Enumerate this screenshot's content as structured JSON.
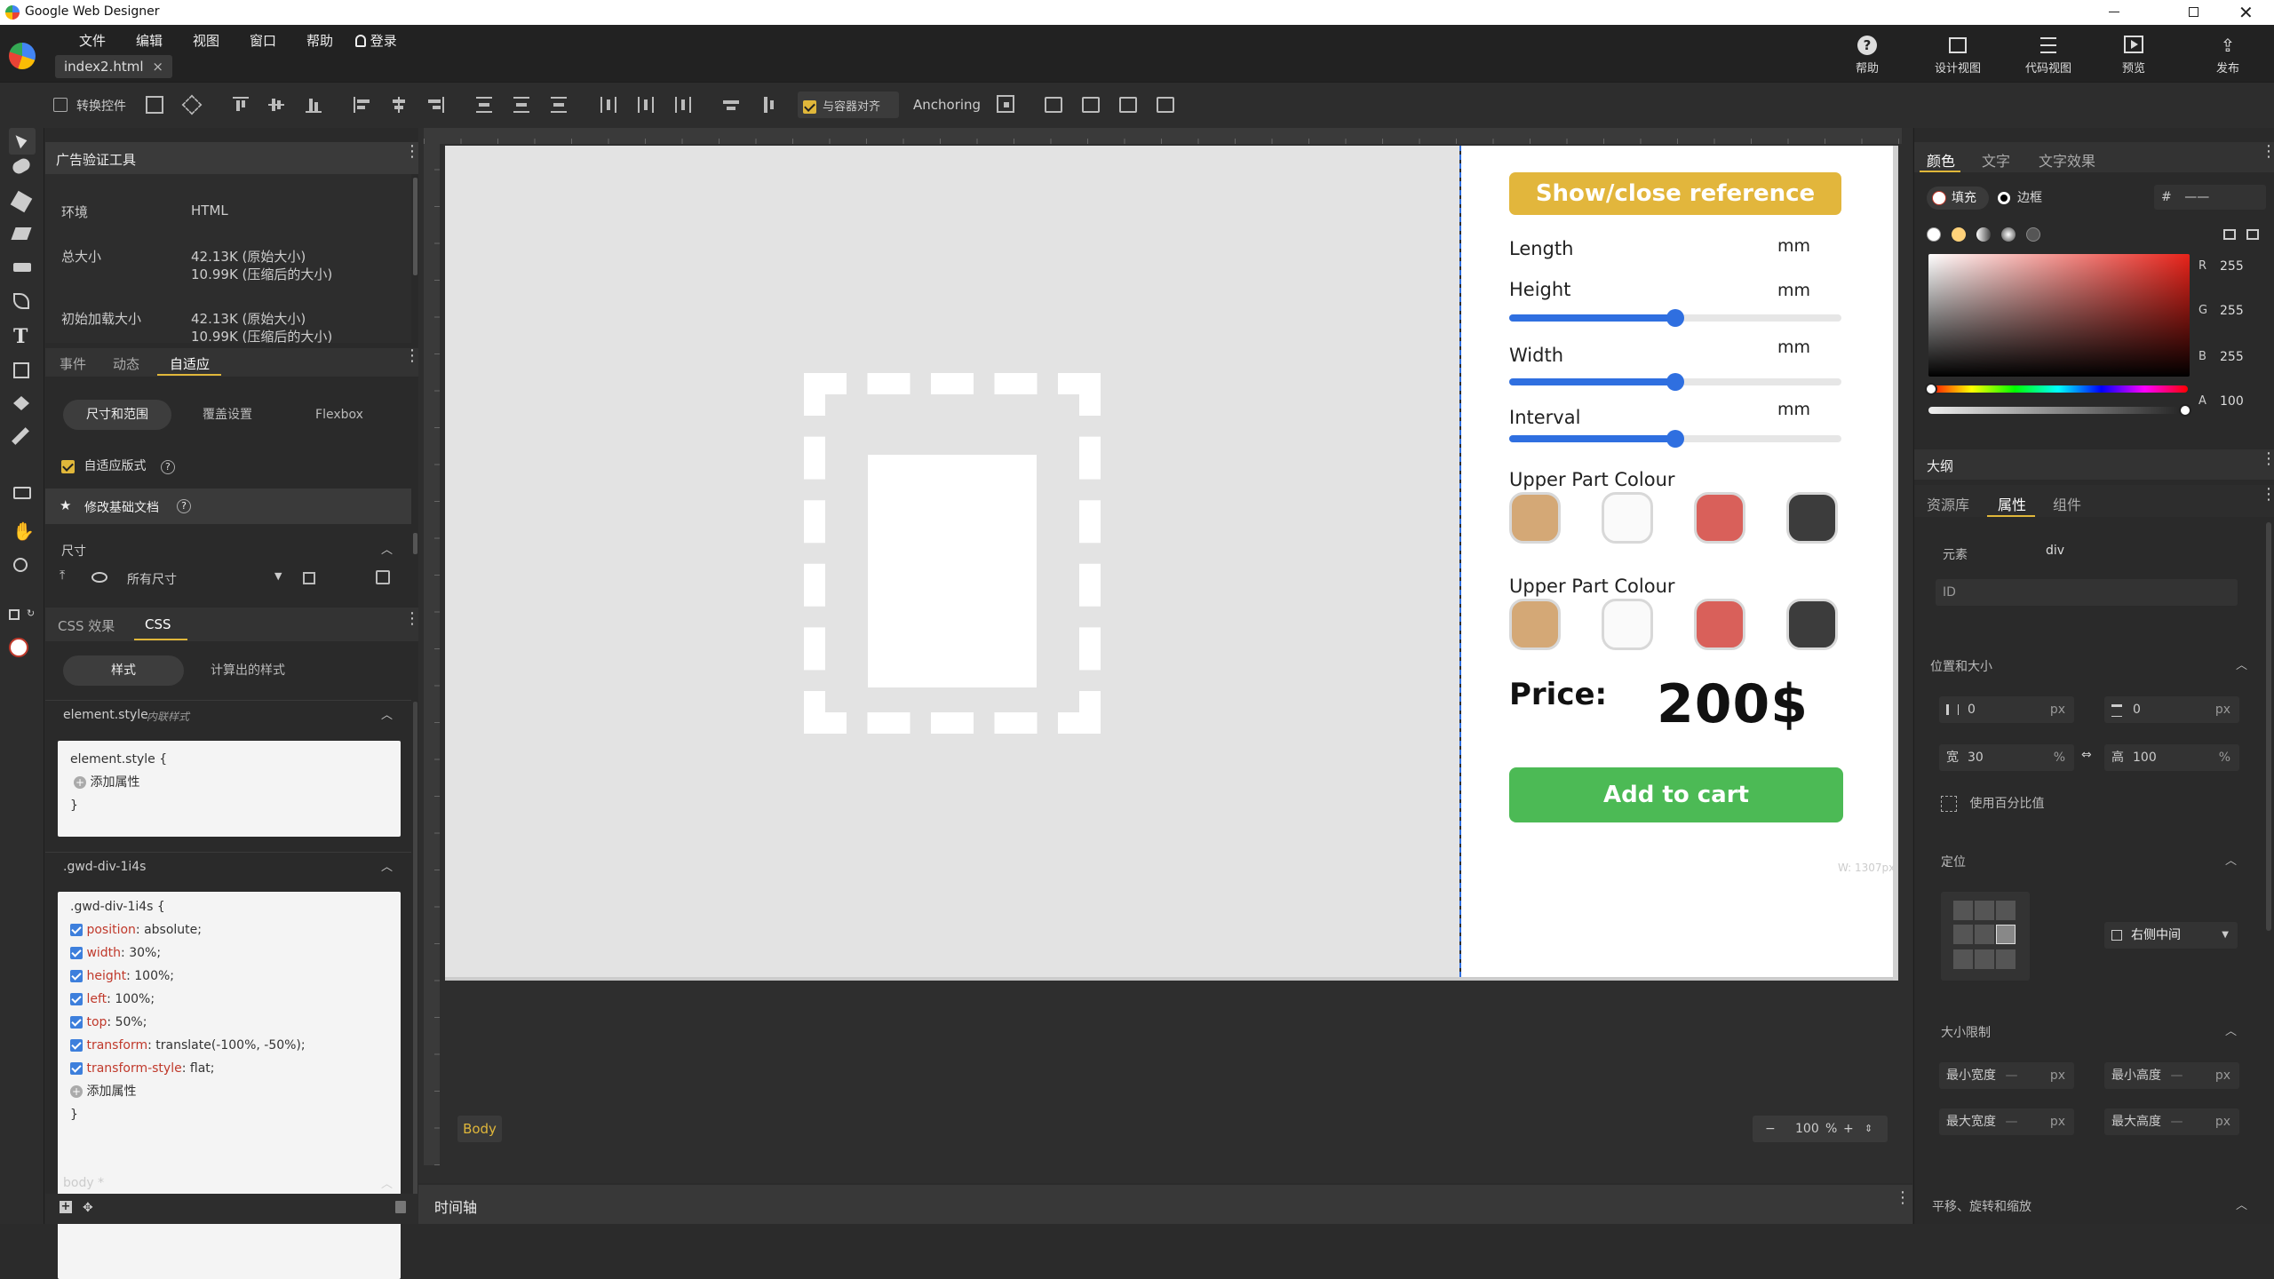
{
  "window": {
    "title": "Google Web Designer"
  },
  "menu": {
    "items": [
      "文件",
      "编辑",
      "视图",
      "窗口",
      "帮助"
    ],
    "login": "登录"
  },
  "file_tab": {
    "name": "index2.html"
  },
  "top_right": {
    "help": "帮助",
    "design_view": "设计视图",
    "code_view": "代码视图",
    "preview": "预览",
    "publish": "发布"
  },
  "toolbar": {
    "transform_label": "转换控件",
    "align_container_label": "与容器对齐",
    "anchoring_label": "Anchoring"
  },
  "ad_validator": {
    "title": "广告验证工具",
    "rows": [
      {
        "label": "环境",
        "value1": "HTML",
        "value2": ""
      },
      {
        "label": "总大小",
        "value1": "42.13K (原始大小)",
        "value2": "10.99K (压缩后的大小)"
      },
      {
        "label": "初始加载大小",
        "value1": "42.13K (原始大小)",
        "value2": "10.99K (压缩后的大小)"
      }
    ]
  },
  "left_tabs": {
    "events": "事件",
    "animation": "动态",
    "responsive": "自适应"
  },
  "responsive": {
    "sub_tabs": [
      "尺寸和范围",
      "覆盖设置",
      "Flexbox"
    ],
    "responsive_layout": "自适应版式",
    "edit_base_doc": "修改基础文档",
    "size_section": "尺寸",
    "all_sizes": "所有尺寸"
  },
  "css_panel": {
    "tab_effects": "CSS 效果",
    "tab_css": "CSS",
    "sub_style": "样式",
    "sub_computed": "计算出的样式",
    "element_style_header": "element.style",
    "element_style_note": "内联样式",
    "element_style_open": "element.style {",
    "add_property": "添加属性",
    "close_brace": "}",
    "class_header": ".gwd-div-1i4s",
    "class_open": ".gwd-div-1i4s {",
    "props": [
      {
        "name": "position",
        "value": "absolute;"
      },
      {
        "name": "width",
        "value": "30%;"
      },
      {
        "name": "height",
        "value": "100%;"
      },
      {
        "name": "left",
        "value": "100%;"
      },
      {
        "name": "top",
        "value": "50%;"
      },
      {
        "name": "transform",
        "value": "translate(-100%, -50%);"
      },
      {
        "name": "transform-style",
        "value": "flat;"
      }
    ],
    "body_header": "body *"
  },
  "stage": {
    "show_button": "Show/close reference",
    "length_label": "Length",
    "height_label": "Height",
    "width_label": "Width",
    "interval_label": "Interval",
    "unit": "mm",
    "sliders": {
      "height": 0.5,
      "width": 0.5,
      "interval": 0.5
    },
    "upper_colour_label": "Upper Part Colour",
    "lower_colour_label": "Upper Part Colour",
    "swatches": [
      "#d4a876",
      "#fafafa",
      "#d9605a",
      "#3c3c3c"
    ],
    "price_label": "Price:",
    "price_value": "200$",
    "cart_button": "Add to cart",
    "width_readout": "W: 1307px"
  },
  "canvas_footer": {
    "breadcrumb": "Body",
    "zoom": "100",
    "zoom_unit": "%"
  },
  "timeline": {
    "label": "时间轴"
  },
  "color_panel": {
    "tabs": [
      "颜色",
      "文字",
      "文字效果"
    ],
    "fill": "填充",
    "border": "边框",
    "hex_prefix": "#",
    "hex_value": "——",
    "r_label": "R",
    "r": "255",
    "g_label": "G",
    "g": "255",
    "b_label": "B",
    "b": "255",
    "a_label": "A",
    "a": "100"
  },
  "outline": {
    "title": "大纲"
  },
  "props_panel": {
    "tabs": [
      "资源库",
      "属性",
      "组件"
    ],
    "element_label": "元素",
    "element_value": "div",
    "id_placeholder": "ID",
    "pos_size": "位置和大小",
    "x": "0",
    "y": "0",
    "unit_px": "px",
    "w_label": "宽",
    "w": "30",
    "h_label": "高",
    "h": "100",
    "unit_pct": "%",
    "use_percent": "使用百分比值",
    "positioning": "定位",
    "position_value": "右侧中间",
    "size_limit": "大小限制",
    "min_w": "最小宽度",
    "min_h": "最小高度",
    "max_w": "最大宽度",
    "max_h": "最大高度",
    "dash": "—",
    "transform_section": "平移、旋转和缩放"
  },
  "colors": {
    "accent": "#e0b73a",
    "blue": "#2f6fe0",
    "green": "#4cba55",
    "gold_button": "#e2b63c"
  }
}
